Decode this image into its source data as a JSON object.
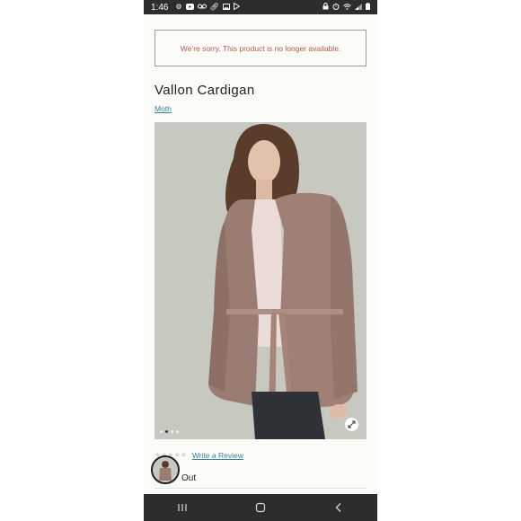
{
  "status_bar": {
    "time": "1:46",
    "left_icons": [
      "gear-icon",
      "youtube-icon",
      "voicemail-icon",
      "link-icon",
      "image-icon",
      "play-store-icon"
    ],
    "right_icons": [
      "lock-icon",
      "alarm-icon",
      "wifi-icon",
      "signal-icon",
      "battery-icon"
    ]
  },
  "alert": {
    "message": "We’re sorry. This product is no longer available."
  },
  "product": {
    "title": "Vallon Cardigan",
    "color_link": "Moth",
    "image_icon": "cardigan-model-photo",
    "carousel": {
      "total_slides": 4,
      "active_index": 1
    },
    "zoom_icon": "expand-icon"
  },
  "reviews": {
    "rating": 0,
    "max_rating": 5,
    "write_review_label": "Write a Review"
  },
  "stock": {
    "status_text": "Out"
  },
  "colors": {
    "accent_link": "#3b7f9c",
    "alert_text": "#b25a52",
    "page_bg": "#fbfbf7",
    "system_bar": "#2d2d2d"
  },
  "nav_bar": {
    "buttons": [
      "recent-apps-icon",
      "home-icon",
      "back-icon"
    ]
  }
}
